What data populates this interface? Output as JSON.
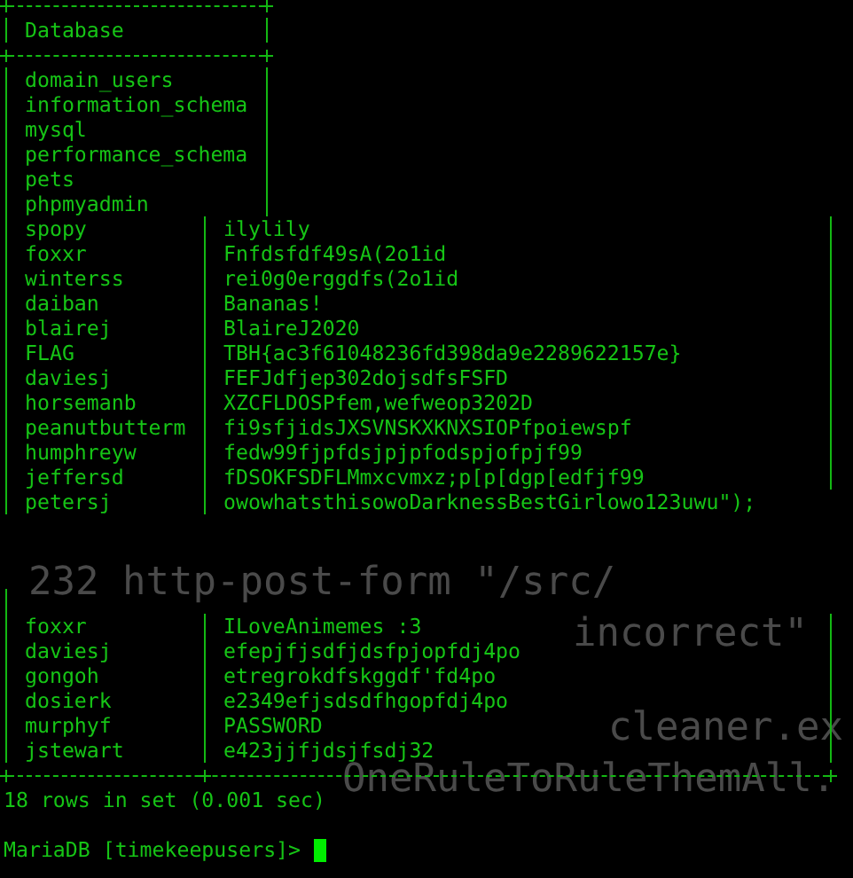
{
  "background_lines": [
    "232 http-post-form \"/src/",
    "incorrect\"",
    "cleaner.ex",
    "OneRuleToRuleThemAll."
  ],
  "databases_table": {
    "header": "Database",
    "rows": [
      "domain_users",
      "information_schema",
      "mysql",
      "performance_schema",
      "pets",
      "phpmyadmin"
    ]
  },
  "users_table": {
    "rows": [
      {
        "kind": "row",
        "user": "spopy",
        "password": "ilylily"
      },
      {
        "kind": "row",
        "user": "foxxr",
        "password": "Fnfdsfdf49sA(2o1id"
      },
      {
        "kind": "row",
        "user": "winterss",
        "password": "rei0g0erggdfs(2o1id"
      },
      {
        "kind": "row",
        "user": "daiban",
        "password": "Bananas!"
      },
      {
        "kind": "row",
        "user": "blairej",
        "password": "BlaireJ2020"
      },
      {
        "kind": "row",
        "user": "FLAG",
        "password": "TBH{ac3f61048236fd398da9e2289622157e}"
      },
      {
        "kind": "row",
        "user": "daviesj",
        "password": "FEFJdfjep302dojsdfsFSFD"
      },
      {
        "kind": "row",
        "user": "horsemanb",
        "password": "XZCFLDOSPfem,wefweop3202D"
      },
      {
        "kind": "row",
        "user": "peanutbutterm",
        "password": "fi9sfjidsJXSVNSKXKNXSIOPfpoiewspf"
      },
      {
        "kind": "row",
        "user": "humphreyw",
        "password": "fedw99fjpfdsjpjpfodspjofpjf99"
      },
      {
        "kind": "row",
        "user": "jeffersd",
        "password": "fDSOKFSDFLMmxcvmxz;p[p[dgp[edfjf99"
      },
      {
        "kind": "open",
        "user": "petersj",
        "password": "owowhatsthisowoDarknessBestGirlowo123uwu\");"
      },
      {
        "kind": "gap"
      },
      {
        "kind": "row",
        "user": "foxxr",
        "password": "ILoveAnimemes :3"
      },
      {
        "kind": "row",
        "user": "daviesj",
        "password": "efepjfjsdfjdsfpjopfdj4po"
      },
      {
        "kind": "row",
        "user": "gongoh",
        "password": "etregrokdfskggdf'fd4po"
      },
      {
        "kind": "row",
        "user": "dosierk",
        "password": "e2349efjsdsdfhgopfdj4po"
      },
      {
        "kind": "row",
        "user": "murphyf",
        "password": "PASSWORD"
      },
      {
        "kind": "row",
        "user": "jstewart",
        "password": "e423jjfjdsjfsdj32"
      }
    ]
  },
  "result_summary": "18 rows in set (0.001 sec)",
  "prompt": "MariaDB [timekeepusers]>"
}
